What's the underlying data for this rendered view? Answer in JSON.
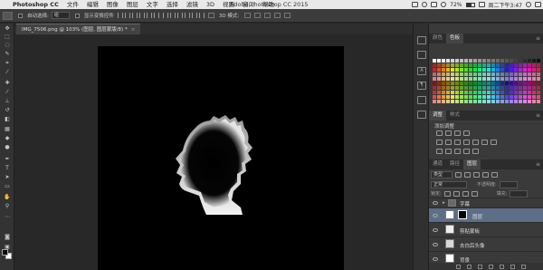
{
  "menubar": {
    "apple": "",
    "app_name": "Photoshop CC",
    "items": [
      "文件",
      "编辑",
      "图像",
      "图层",
      "文字",
      "选择",
      "滤镜",
      "3D",
      "视图",
      "窗口",
      "帮助"
    ],
    "window_title": "Adobe Photoshop CC 2015",
    "battery": "72%",
    "battery_level": 0.72,
    "clock": "周二下午3:47"
  },
  "options_bar": {
    "auto_select_label": "自动选择:",
    "auto_select_value": "组",
    "show_transform_label": "显示变换控件",
    "mode_3d_label": "3D 模式:"
  },
  "document_tab": {
    "label": "IMG_7506.png @ 103% (图层, 图层蒙版/8) *",
    "close": "×"
  },
  "panels": {
    "swatches_tabs": [
      "颜色",
      "色板"
    ],
    "adjustments_tabs": [
      "调整",
      "样式"
    ],
    "adjustments_add": "添加调整",
    "layers_tabs": [
      "通道",
      "路径",
      "图层"
    ],
    "kind_label": "类型",
    "blend_mode": "正常",
    "opacity_label": "不透明度:",
    "lock_label": "锁定:",
    "fill_label": "填充:",
    "menu_glyph": "≡"
  },
  "layers": [
    {
      "name": "字幕",
      "type": "group"
    },
    {
      "name": "图层",
      "type": "mask",
      "selected": true
    },
    {
      "name": "剪贴蒙板",
      "type": "layer"
    },
    {
      "name": "去白后头像",
      "type": "layer"
    },
    {
      "name": "背景",
      "type": "background"
    }
  ],
  "colors": {
    "canvas_bg": "#000000",
    "selected_layer": "#5d6f88",
    "panel_bg": "#3a3a3a"
  }
}
